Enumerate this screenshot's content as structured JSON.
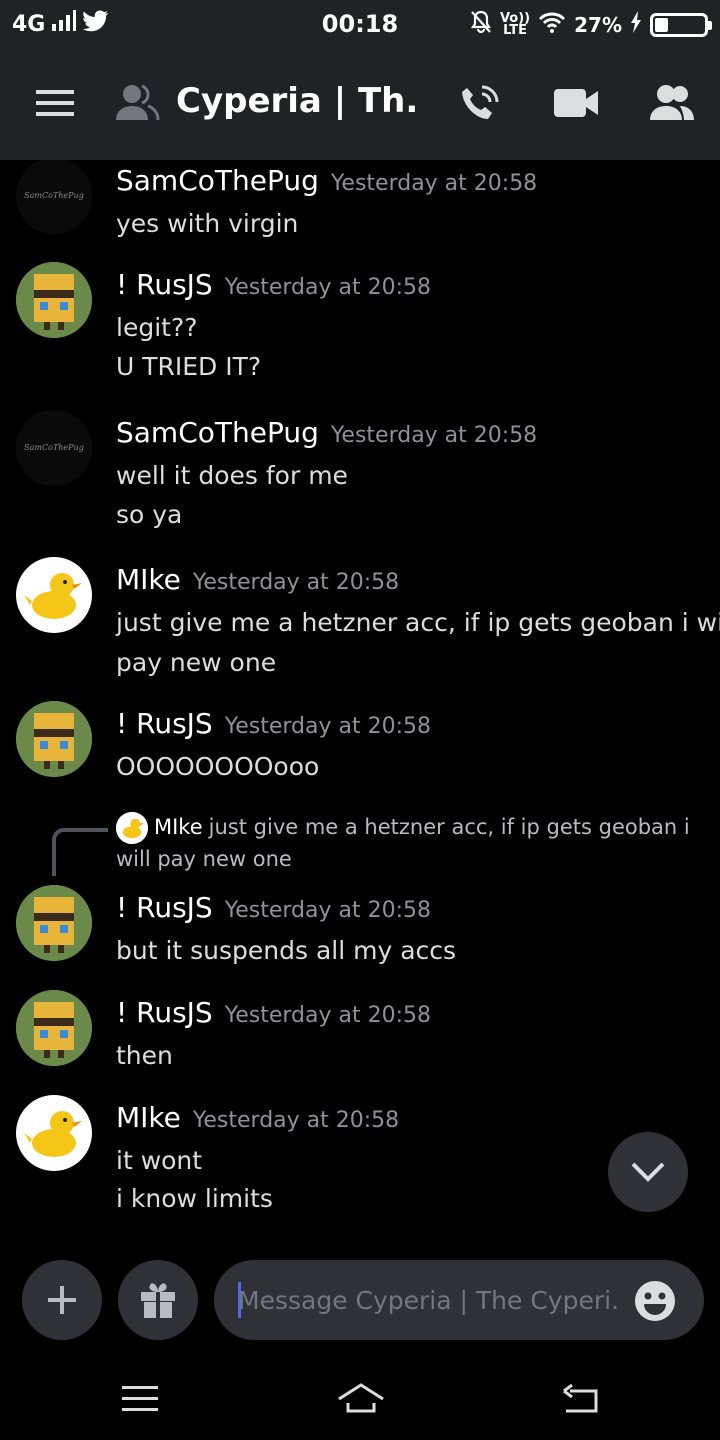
{
  "status_bar": {
    "network": "4G",
    "time": "00:18",
    "lte_top": "Vo))",
    "lte_bottom": "LTE",
    "battery_percent": "27%",
    "battery_level": 0.27,
    "icons": [
      "signal-icon",
      "twitter-icon",
      "mute-icon",
      "wifi-icon",
      "charging-icon",
      "battery-icon"
    ]
  },
  "header": {
    "channel_title": "Cyperia | Th...",
    "icons": [
      "menu-icon",
      "dm-people-icon",
      "voice-call-icon",
      "video-call-icon",
      "members-icon"
    ]
  },
  "messages": [
    {
      "author": "SamCoThePug",
      "timestamp": "Yesterday at 20:58",
      "avatar_text": "SamCoThePug",
      "lines": [
        "yes with virgin"
      ]
    },
    {
      "author": "! RusJS",
      "timestamp": "Yesterday at 20:58",
      "lines": [
        "legit??",
        "U TRIED IT?"
      ]
    },
    {
      "author": "SamCoThePug",
      "timestamp": "Yesterday at 20:58",
      "avatar_text": "SamCoThePug",
      "lines": [
        "well it does for me",
        "so ya"
      ]
    },
    {
      "author": "MIke",
      "timestamp": "Yesterday at 20:58",
      "lines": [
        "just give me a hetzner acc, if ip gets geoban i will",
        "pay new one"
      ]
    },
    {
      "author": "! RusJS",
      "timestamp": "Yesterday at 20:58",
      "lines": [
        "OOOOOOOOooo"
      ]
    },
    {
      "author": "! RusJS",
      "timestamp": "Yesterday at 20:58",
      "lines": [
        "but it suspends all my accs"
      ]
    },
    {
      "author": "! RusJS",
      "timestamp": "Yesterday at 20:58",
      "lines": [
        "then"
      ]
    },
    {
      "author": "MIke",
      "timestamp": "Yesterday at 20:58",
      "lines": [
        "it wont",
        "i know limits"
      ]
    }
  ],
  "reply_reference": {
    "author": "MIke",
    "text": "just give me a hetzner acc, if ip gets geoban i will pay new one"
  },
  "composer": {
    "placeholder": "Message Cyperia | The Cyperi...",
    "value": ""
  },
  "colors": {
    "background": "#000000",
    "header_bg": "#202225",
    "surface": "#2f3136",
    "accent": "#5865f2",
    "timestamp": "#8e9297"
  }
}
